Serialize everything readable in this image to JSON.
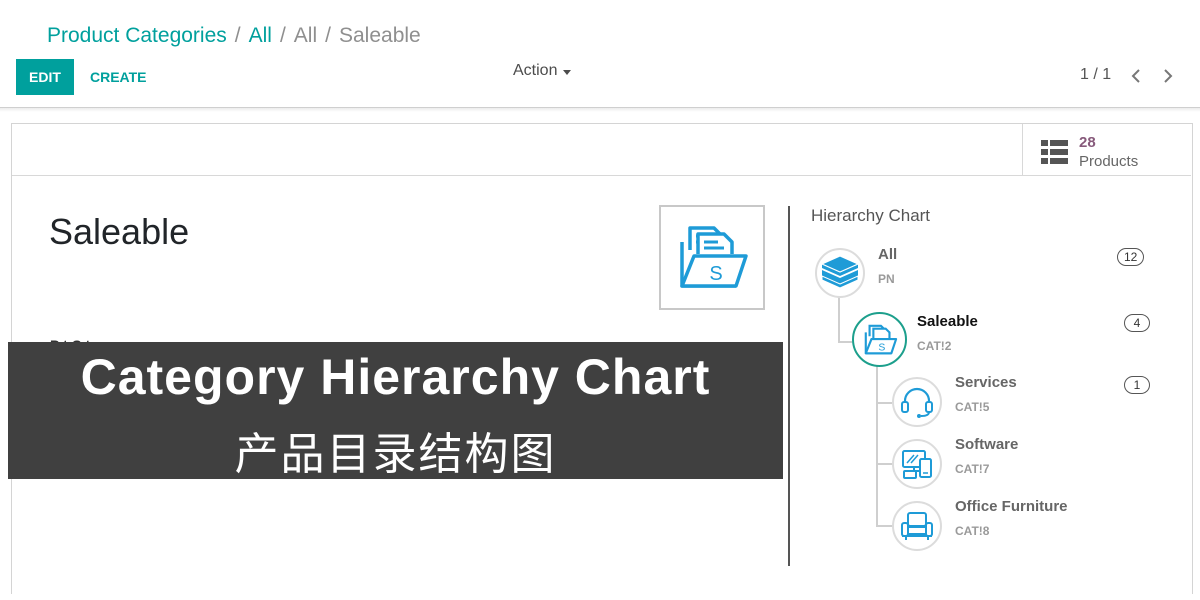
{
  "breadcrumb": {
    "items": [
      "Product Categories",
      "All",
      "All"
    ],
    "separator": "/",
    "current": "Saleable"
  },
  "toolbar": {
    "edit_label": "EDIT",
    "create_label": "CREATE",
    "action_label": "Action",
    "pager": "1 / 1"
  },
  "stat_button": {
    "count": "28",
    "label": "Products",
    "icon": "list-icon"
  },
  "record": {
    "name": "Saleable",
    "image_icon": "folder-s-icon",
    "partial_field_label": "P        t C  t"
  },
  "hierarchy": {
    "title": "Hierarchy Chart",
    "nodes": [
      {
        "name": "All",
        "code": "PN",
        "count": "12",
        "icon": "layers-icon"
      },
      {
        "name": "Saleable",
        "code": "CAT!2",
        "count": "4",
        "icon": "folder-s-icon"
      },
      {
        "name": "Services",
        "code": "CAT!5",
        "count": "1",
        "icon": "headset-icon"
      },
      {
        "name": "Software",
        "code": "CAT!7",
        "icon": "devices-icon"
      },
      {
        "name": "Office Furniture",
        "code": "CAT!8",
        "icon": "armchair-icon"
      }
    ]
  },
  "banner": {
    "title": "Category Hierarchy Chart",
    "subtitle": "产品目录结构图"
  },
  "colors": {
    "primary": "#00a09d",
    "stat_number": "#875a7b",
    "icon_blue": "#1e9bd7",
    "banner_bg": "#404040"
  }
}
